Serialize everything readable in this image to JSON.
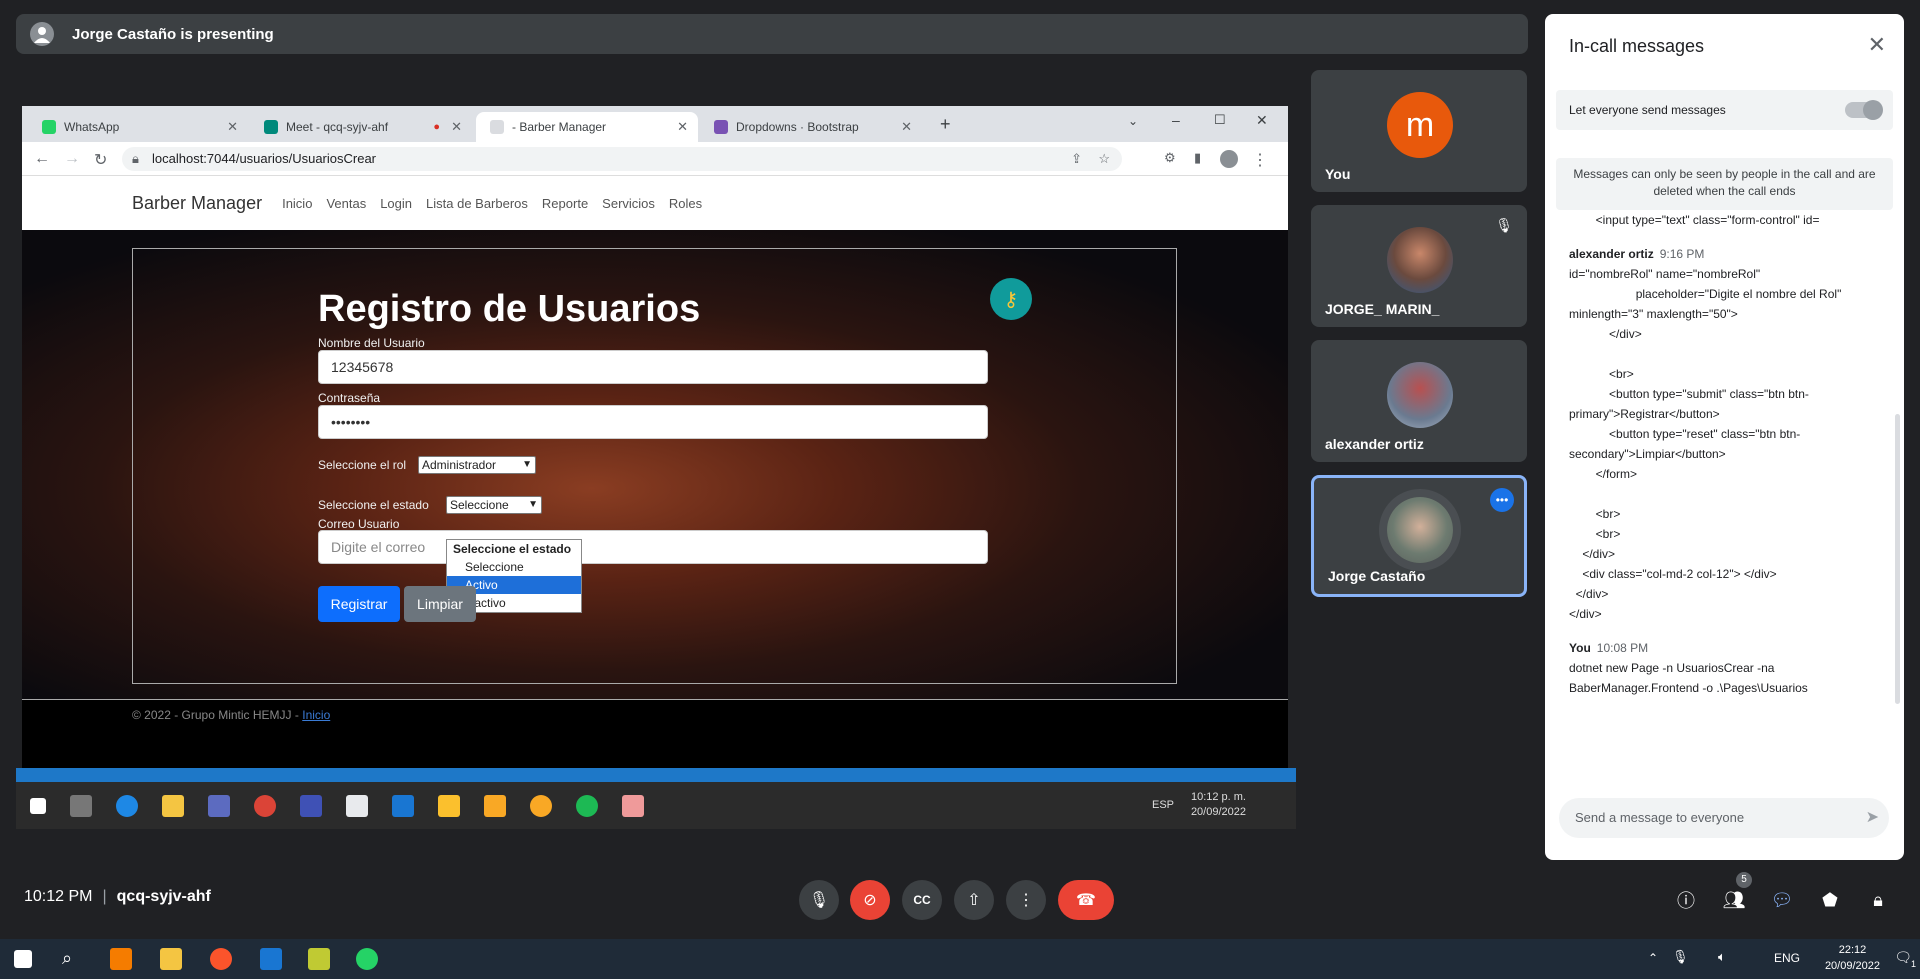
{
  "presenting": {
    "text": "Jorge Castaño is presenting"
  },
  "browser": {
    "tabs": [
      {
        "label": "WhatsApp",
        "color": "#25d366"
      },
      {
        "label": "Meet - qcq-syjv-ahf",
        "color": "#00897b"
      },
      {
        "label": "- Barber Manager",
        "color": "#9e9e9e"
      },
      {
        "label": "Dropdowns · Bootstrap",
        "color": "#7952b3"
      }
    ],
    "url": "localhost:7044/usuarios/UsuariosCrear"
  },
  "site": {
    "brand": "Barber Manager",
    "nav": [
      "Inicio",
      "Ventas",
      "Login",
      "Lista de Barberos",
      "Reporte",
      "Servicios",
      "Roles"
    ],
    "form_title": "Registro de Usuarios",
    "username_label": "Nombre del Usuario",
    "username_value": "12345678",
    "password_label": "Contraseña",
    "password_value": "••••••••",
    "role_label": "Seleccione el rol",
    "role_value": "Administrador",
    "state_label": "Seleccione el estado",
    "state_value": "Seleccione",
    "state_options": {
      "header": "Seleccione el estado",
      "opt1": "Seleccione",
      "opt2": "Activo",
      "opt3": "inactivo"
    },
    "email_label": "Correo Usuario",
    "email_placeholder": "Digite el correo",
    "register_btn": "Registrar",
    "clear_btn": "Limpiar",
    "footer_text": "© 2022 - Grupo Mintic HEMJJ - ",
    "footer_link": "Inicio"
  },
  "inner_taskbar": {
    "time": "10:12 p. m.",
    "date": "20/09/2022",
    "lang": "ESP"
  },
  "participants": [
    {
      "name": "You",
      "initial": "m"
    },
    {
      "name": "JORGE_ MARIN_"
    },
    {
      "name": "alexander ortiz"
    },
    {
      "name": "Jorge Castaño"
    }
  ],
  "chat": {
    "title": "In-call messages",
    "let_everyone": "Let everyone send messages",
    "info": "Messages can only be seen by people in the call and are deleted when the call ends",
    "msg0": "        <input type=\"text\" class=\"form-control\" id=",
    "msg1_author": "alexander ortiz",
    "msg1_time": "9:16 PM",
    "msg1_body": "id=\"nombreRol\" name=\"nombreRol\"\n                    placeholder=\"Digite el nombre del Rol\" minlength=\"3\" maxlength=\"50\">\n            </div>\n\n            <br>\n            <button type=\"submit\" class=\"btn btn-primary\">Registrar</button>\n            <button type=\"reset\" class=\"btn btn-secondary\">Limpiar</button>\n        </form>\n\n        <br>\n        <br>\n    </div>\n    <div class=\"col-md-2 col-12\"> </div>\n  </div>\n</div>",
    "msg2_author": "You",
    "msg2_time": "10:08 PM",
    "msg2_body": "dotnet new Page -n UsuariosCrear -na BaberManager.Frontend -o .\\Pages\\Usuarios",
    "input_placeholder": "Send a message to everyone"
  },
  "meeting": {
    "time": "10:12 PM",
    "code": "qcq-syjv-ahf",
    "people_count": "5"
  },
  "taskbar": {
    "lang": "ENG",
    "time": "22:12",
    "date": "20/09/2022",
    "notif": "1"
  }
}
